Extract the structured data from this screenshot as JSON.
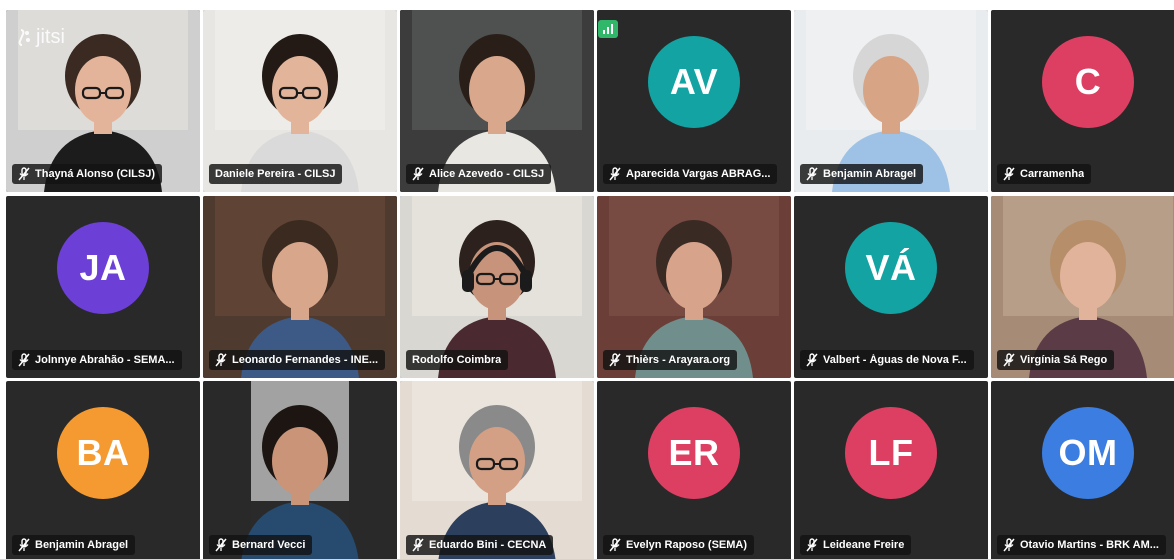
{
  "app": {
    "brand": "jitsi"
  },
  "participants": [
    {
      "name": "Thayná Alonso (CILSJ)",
      "muted": true,
      "video": true
    },
    {
      "name": "Daniele Pereira - CILSJ",
      "muted": false,
      "video": true
    },
    {
      "name": "Alice Azevedo - CILSJ",
      "muted": true,
      "video": true
    },
    {
      "name": "Aparecida Vargas ABRAG...",
      "muted": true,
      "video": false,
      "initials": "AV",
      "color": "#13a3a3"
    },
    {
      "name": "Benjamin Abragel",
      "muted": true,
      "video": true
    },
    {
      "name": "Carramenha",
      "muted": true,
      "video": false,
      "initials": "C",
      "color": "#dd3f62"
    },
    {
      "name": "Jolnnye Abrahão - SEMA...",
      "muted": true,
      "video": false,
      "initials": "JA",
      "color": "#6c3fd6"
    },
    {
      "name": "Leonardo Fernandes - INE...",
      "muted": true,
      "video": true
    },
    {
      "name": "Rodolfo Coimbra",
      "muted": false,
      "video": true,
      "dominant": true
    },
    {
      "name": "Thièrs - Arayara.org",
      "muted": true,
      "video": true
    },
    {
      "name": "Valbert - Águas de Nova F...",
      "muted": true,
      "video": false,
      "initials": "VÁ",
      "color": "#13a3a3"
    },
    {
      "name": "Virgínia Sá Rego",
      "muted": true,
      "video": true
    },
    {
      "name": "Benjamin Abragel",
      "muted": true,
      "video": false,
      "initials": "BA",
      "color": "#f59a31"
    },
    {
      "name": "Bernard Vecci",
      "muted": true,
      "video": true
    },
    {
      "name": "Eduardo Bini - CECNA",
      "muted": true,
      "video": true
    },
    {
      "name": "Evelyn Raposo (SEMA)",
      "muted": true,
      "video": false,
      "initials": "ER",
      "color": "#dd3f62"
    },
    {
      "name": "Leideane Freire",
      "muted": true,
      "video": false,
      "initials": "LF",
      "color": "#dd3f62"
    },
    {
      "name": "Otavio Martins - BRK AM...",
      "muted": true,
      "video": false,
      "initials": "OM",
      "color": "#3b7de0"
    }
  ]
}
